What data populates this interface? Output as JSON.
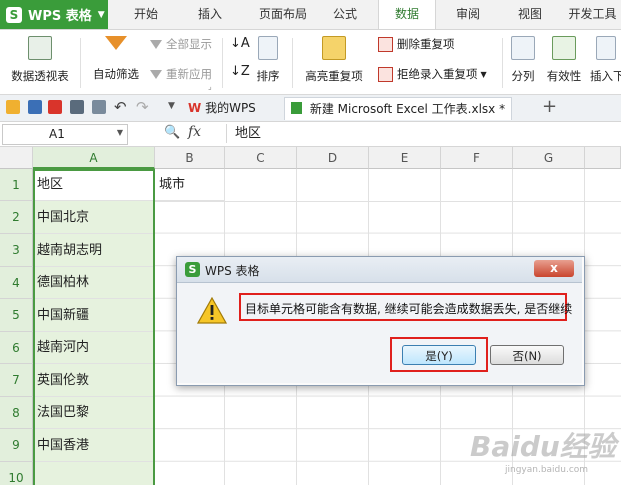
{
  "app": {
    "name": "WPS 表格",
    "logo_glyph": "S",
    "brand_color": "#3a9c3a"
  },
  "ribbon_tabs": [
    "开始",
    "插入",
    "页面布局",
    "公式",
    "数据",
    "审阅",
    "视图",
    "开发工具"
  ],
  "ribbon_active_tab": "数据",
  "ribbon": {
    "pivot": "数据透视表",
    "autofilter": "自动筛选",
    "show_all": "全部显示",
    "reapply": "重新应用",
    "sort": "排序",
    "highlight_dup": "高亮重复项",
    "delete_dup": "删除重复项",
    "reject_dup": "拒绝录入重复项",
    "split": "分列",
    "validity": "有效性",
    "insert_more": "插入下"
  },
  "doc_tabs": [
    {
      "label": "我的WPS",
      "active": false
    },
    {
      "label": "新建 Microsoft Excel 工作表.xlsx *",
      "active": true
    }
  ],
  "formula_bar": {
    "name_box": "A1",
    "fx": "fx",
    "content": "地区"
  },
  "columns": [
    "A",
    "B",
    "C",
    "D",
    "E",
    "F",
    "G"
  ],
  "rows": [
    "1",
    "2",
    "3",
    "4",
    "5",
    "6",
    "7",
    "8",
    "9",
    "10"
  ],
  "cells": {
    "A": [
      "地区",
      "中国北京",
      "越南胡志明",
      "德国柏林",
      "中国新疆",
      "越南河内",
      "英国伦敦",
      "法国巴黎",
      "中国香港",
      ""
    ],
    "B1": "城市"
  },
  "dialog": {
    "title": "WPS 表格",
    "close": "x",
    "message": "目标单元格可能含有数据, 继续可能会造成数据丢失, 是否继续",
    "yes": "是(Y)",
    "no": "否(N)"
  },
  "watermark": {
    "text": "Baidu经验",
    "sub": "jingyan.baidu.com"
  }
}
